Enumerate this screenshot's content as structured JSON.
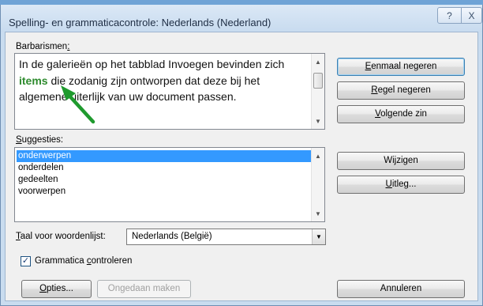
{
  "window": {
    "title": "Spelling- en grammaticacontrole: Nederlands (Nederland)",
    "help_glyph": "?",
    "close_glyph": "X"
  },
  "barbarisms": {
    "label_main": "Barbarismen",
    "label_colon": ":",
    "text_before": "In de galerieën op het tabblad Invoegen bevinden zich ",
    "flagged_word": "items",
    "text_after": " die zodanig zijn ontworpen dat deze bij het algemene uiterlijk van uw document passen."
  },
  "suggestions": {
    "label_mnemonic": "S",
    "label_rest": "uggesties:",
    "items": [
      "onderwerpen",
      "onderdelen",
      "gedeelten",
      "voorwerpen"
    ],
    "selected": "onderwerpen"
  },
  "buttons": {
    "ignore_once": {
      "mn": "E",
      "rest": "enmaal negeren"
    },
    "ignore_rule": {
      "mn": "R",
      "rest": "egel negeren"
    },
    "next_sentence": {
      "mn": "V",
      "rest": "olgende zin"
    },
    "change": {
      "pre": "Wi",
      "mn": "j",
      "rest": "zigen"
    },
    "explain": {
      "mn": "U",
      "rest": "itleg..."
    },
    "options": {
      "mn": "O",
      "rest": "pties..."
    },
    "undo": "Ongedaan maken",
    "cancel": "Annuleren"
  },
  "dictionary": {
    "label_mn": "T",
    "label_rest": "aal voor woordenlijst:",
    "value": "Nederlands (België)"
  },
  "grammar_check": {
    "pre": "Grammatica ",
    "mn": "c",
    "rest": "ontroleren",
    "checked": true,
    "check_glyph": "✓"
  },
  "icons": {
    "scroll_up": "▲",
    "scroll_down": "▼",
    "dropdown": "▼"
  },
  "colors": {
    "highlight_word": "#2e8b2e",
    "annotation_arrow": "#1f9a2e",
    "selection": "#3399ff"
  }
}
